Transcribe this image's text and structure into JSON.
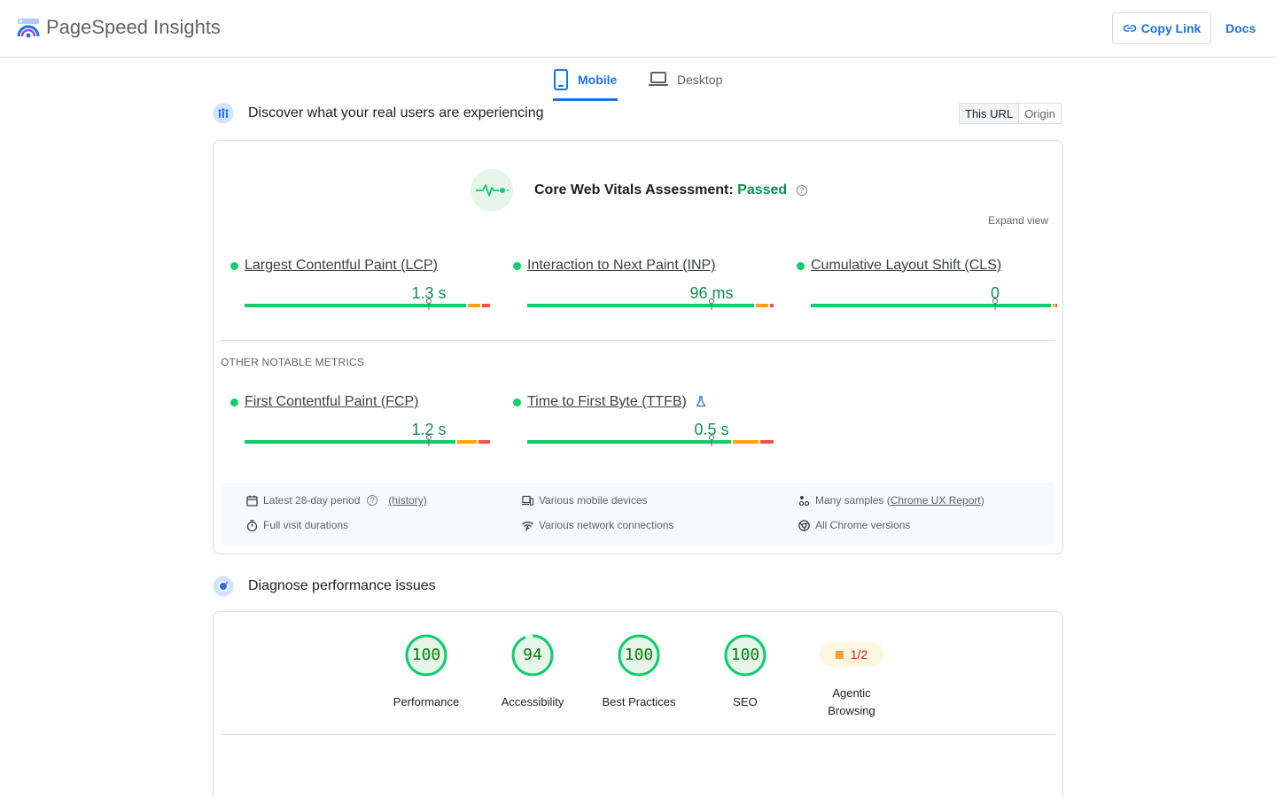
{
  "app": {
    "brand": "PageSpeed Insights",
    "copy_link": "Copy Link",
    "docs": "Docs"
  },
  "tabs": [
    {
      "label": "Mobile",
      "active": true
    },
    {
      "label": "Desktop",
      "active": false
    }
  ],
  "field_section": {
    "title": "Discover what your real users are experiencing",
    "toggle": [
      "This URL",
      "Origin"
    ],
    "toggle_selected": "This URL"
  },
  "assessment": {
    "label": "Core Web Vitals Assessment:",
    "status": "Passed",
    "expand": "Expand view"
  },
  "core_metrics": [
    {
      "name": "Largest Contentful Paint (LCP)",
      "value": "1.3 s",
      "status": "good"
    },
    {
      "name": "Interaction to Next Paint (INP)",
      "value": "96 ms",
      "status": "good"
    },
    {
      "name": "Cumulative Layout Shift (CLS)",
      "value": "0",
      "status": "good"
    }
  ],
  "other_label": "OTHER NOTABLE METRICS",
  "other_metrics": [
    {
      "name": "First Contentful Paint (FCP)",
      "value": "1.2 s",
      "status": "good"
    },
    {
      "name": "Time to First Byte (TTFB)",
      "value": "0.5 s",
      "status": "good",
      "experimental": true
    }
  ],
  "info": {
    "period": "Latest 28-day period",
    "history": "(history)",
    "devices": "Various mobile devices",
    "samples_prefix": "Many samples (",
    "samples_link": "Chrome UX Report",
    "samples_suffix": ")",
    "durations": "Full visit durations",
    "network": "Various network connections",
    "chrome": "All Chrome versions"
  },
  "diagnose_section": {
    "title": "Diagnose performance issues"
  },
  "scores": [
    {
      "value": 100,
      "label": "Performance"
    },
    {
      "value": 94,
      "label": "Accessibility"
    },
    {
      "value": 100,
      "label": "Best Practices"
    },
    {
      "value": 100,
      "label": "SEO"
    }
  ],
  "agentic": {
    "value": "1/2",
    "label": "Agentic Browsing"
  },
  "colors": {
    "accent": "#1a73e8",
    "good": "#0cce6b",
    "good_text": "#0d904f",
    "average": "#ffa400",
    "poor": "#ff4e42"
  }
}
